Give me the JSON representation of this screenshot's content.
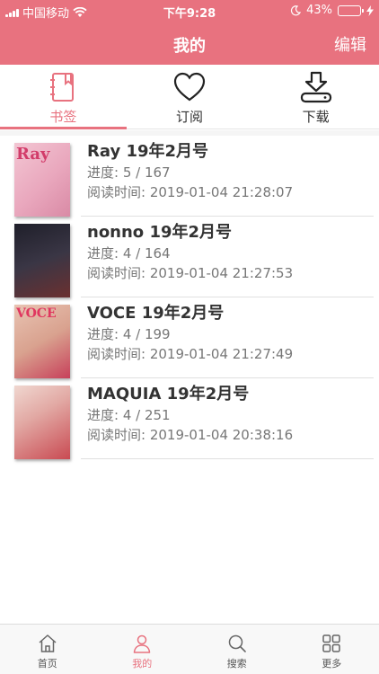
{
  "status": {
    "carrier": "中国移动",
    "time": "下午9:28",
    "battery": "43%",
    "battery_level": 0.43
  },
  "nav": {
    "title": "我的",
    "edit": "编辑"
  },
  "tabs": [
    {
      "label": "书签",
      "icon": "bookmark-book-icon",
      "active": true
    },
    {
      "label": "订阅",
      "icon": "heart-icon",
      "active": false
    },
    {
      "label": "下载",
      "icon": "download-icon",
      "active": false
    }
  ],
  "items": [
    {
      "title": "Ray 19年2月号",
      "progress": "进度: 5 / 167",
      "read_time": "阅读时间: 2019-01-04 21:28:07",
      "cover_text": "Ray",
      "cover_color": "#e9a7bd"
    },
    {
      "title": "nonno 19年2月号",
      "progress": "进度: 4 / 164",
      "read_time": "阅读时间: 2019-01-04 21:27:53",
      "cover_text": "",
      "cover_color": "#2c2c3a"
    },
    {
      "title": "VOCE 19年2月号",
      "progress": "进度: 4 / 199",
      "read_time": "阅读时间: 2019-01-04 21:27:49",
      "cover_text": "VOCE",
      "cover_color": "#d9a28f"
    },
    {
      "title": "MAQUIA 19年2月号",
      "progress": "进度: 4 / 251",
      "read_time": "阅读时间: 2019-01-04 20:38:16",
      "cover_text": "",
      "cover_color": "#c94a52"
    }
  ],
  "bottom_tabs": [
    {
      "label": "首页",
      "icon": "home-icon",
      "active": false
    },
    {
      "label": "我的",
      "icon": "person-icon",
      "active": true
    },
    {
      "label": "搜索",
      "icon": "search-icon",
      "active": false
    },
    {
      "label": "更多",
      "icon": "grid-icon",
      "active": false
    }
  ],
  "colors": {
    "accent": "#e8727f"
  }
}
